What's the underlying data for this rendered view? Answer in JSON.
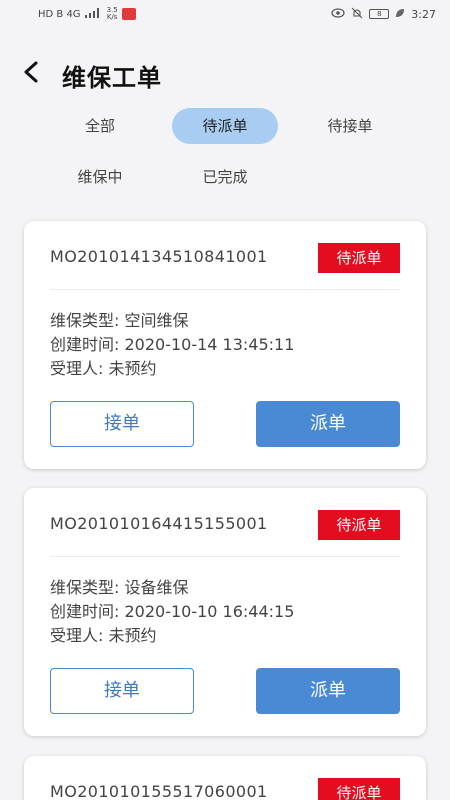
{
  "status_bar": {
    "speed": "3.5\nK/s",
    "battery": "8",
    "time": "3:27",
    "signal_text": "HD B 4G",
    "wifi_label": "wifi"
  },
  "header": {
    "title": "维保工单",
    "back_icon": "chevron-left-icon"
  },
  "tabs": [
    {
      "label": "全部",
      "active": false
    },
    {
      "label": "待派单",
      "active": true
    },
    {
      "label": "待接单",
      "active": false
    },
    {
      "label": "维保中",
      "active": false
    },
    {
      "label": "已完成",
      "active": false
    }
  ],
  "orders": [
    {
      "number": "MO201014134510841001",
      "status": "待派单",
      "type_line": "维保类型: 空间维保",
      "created_line": "创建时间: 2020-10-14 13:45:11",
      "handler_line": "受理人: 未预约",
      "accept_label": "接单",
      "dispatch_label": "派单"
    },
    {
      "number": "MO201010164415155001",
      "status": "待派单",
      "type_line": "维保类型: 设备维保",
      "created_line": "创建时间: 2020-10-10 16:44:15",
      "handler_line": "受理人: 未预约",
      "accept_label": "接单",
      "dispatch_label": "派单"
    },
    {
      "number": "MO201010155517060001",
      "status": "待派单"
    }
  ],
  "colors": {
    "accent": "#4a8ad4",
    "badge": "#e30d1f",
    "active_tab": "#a9cdf2"
  }
}
